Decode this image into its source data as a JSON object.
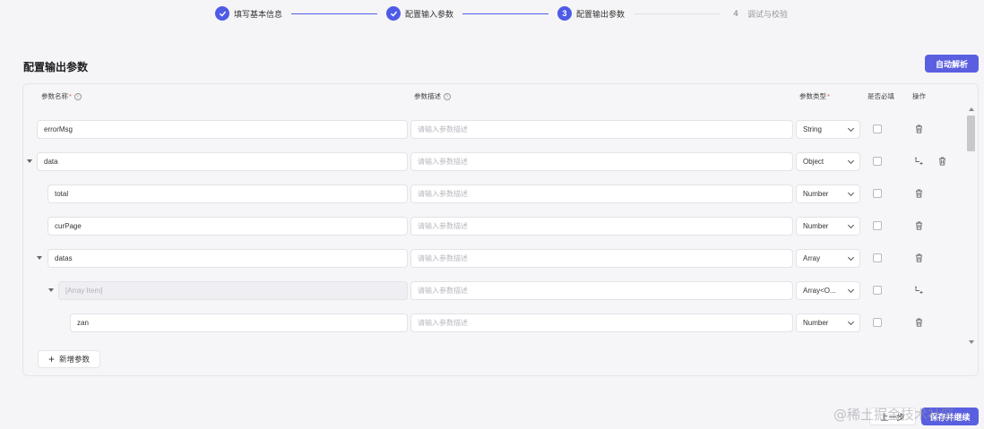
{
  "stepper": {
    "steps": [
      {
        "index": "1",
        "label": "填写基本信息",
        "state": "done"
      },
      {
        "index": "2",
        "label": "配置输入参数",
        "state": "done"
      },
      {
        "index": "3",
        "label": "配置输出参数",
        "state": "active"
      },
      {
        "index": "4",
        "label": "调试与校验",
        "state": "todo"
      }
    ]
  },
  "page_title": "配置输出参数",
  "auto_parse_label": "自动解析",
  "columns": {
    "name": "参数名称",
    "description": "参数描述",
    "type": "参数类型",
    "required": "是否必填",
    "actions": "操作"
  },
  "description_placeholder": "请输入参数描述",
  "rows": [
    {
      "name": "errorMsg",
      "type": "String",
      "expandable": false,
      "disabled": false,
      "add_child": false
    },
    {
      "name": "data",
      "type": "Object",
      "expandable": true,
      "disabled": false,
      "add_child": true
    },
    {
      "name": "total",
      "type": "Number",
      "expandable": false,
      "disabled": false,
      "add_child": false
    },
    {
      "name": "curPage",
      "type": "Number",
      "expandable": false,
      "disabled": false,
      "add_child": false
    },
    {
      "name": "datas",
      "type": "Array",
      "expandable": true,
      "disabled": false,
      "add_child": false
    },
    {
      "name": "[Array Item]",
      "type": "Array<O...",
      "expandable": true,
      "disabled": true,
      "add_child": true
    },
    {
      "name": "zan",
      "type": "Number",
      "expandable": false,
      "disabled": false,
      "add_child": false
    }
  ],
  "add_param_label": "新增参数",
  "footer": {
    "prev_label": "上一步",
    "save_label": "保存并继续"
  },
  "watermark": "@稀土掘金技术社区",
  "colors": {
    "accent": "#5a5fe0",
    "required": "#e5484d"
  }
}
